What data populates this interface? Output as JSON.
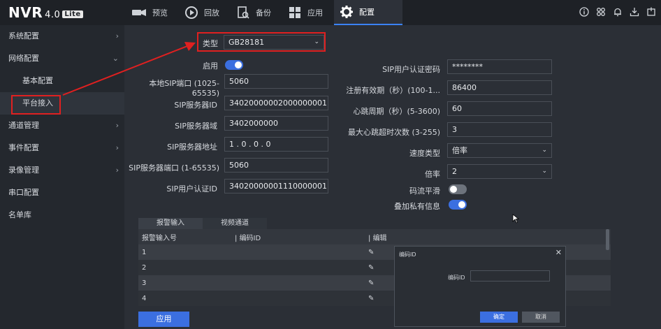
{
  "app": {
    "logo": "NVR",
    "version": "4.0",
    "edition": "Lite"
  },
  "nav": [
    {
      "label": "预览",
      "icon": "camera-icon"
    },
    {
      "label": "回放",
      "icon": "playback-icon"
    },
    {
      "label": "备份",
      "icon": "backup-icon"
    },
    {
      "label": "应用",
      "icon": "apps-icon"
    },
    {
      "label": "配置",
      "icon": "gear-icon"
    }
  ],
  "sidebar": {
    "items": [
      {
        "label": "系统配置"
      },
      {
        "label": "网络配置"
      },
      {
        "label": "基本配置"
      },
      {
        "label": "平台接入"
      },
      {
        "label": "通道管理"
      },
      {
        "label": "事件配置"
      },
      {
        "label": "录像管理"
      },
      {
        "label": "串口配置"
      },
      {
        "label": "名单库"
      }
    ]
  },
  "form": {
    "type_label": "类型",
    "type_value": "GB28181",
    "enable_label": "启用",
    "local_sip_port_label": "本地SIP端口 (1025-65535)",
    "local_sip_port_value": "5060",
    "sip_server_id_label": "SIP服务器ID",
    "sip_server_id_value": "34020000002000000001",
    "sip_server_domain_label": "SIP服务器域",
    "sip_server_domain_value": "3402000000",
    "sip_server_addr_label": "SIP服务器地址",
    "sip_server_addr_value": "1 . 0 . 0 . 0",
    "sip_server_port_label": "SIP服务器端口 (1-65535)",
    "sip_server_port_value": "5060",
    "sip_user_id_label": "SIP用户认证ID",
    "sip_user_id_value": "34020000001110000001",
    "sip_password_label": "SIP用户认证密码",
    "sip_password_value": "********",
    "register_period_label": "注册有效期（秒）(100-1...",
    "register_period_value": "86400",
    "heartbeat_label": "心跳周期（秒）(5-3600)",
    "heartbeat_value": "60",
    "max_timeout_label": "最大心跳超时次数 (3-255)",
    "max_timeout_value": "3",
    "speed_type_label": "速度类型",
    "speed_type_value": "倍率",
    "rate_label": "倍率",
    "rate_value": "2",
    "stream_smooth_label": "码流平滑",
    "private_info_label": "叠加私有信息"
  },
  "table": {
    "tabs": [
      "报警输入",
      "视频通道"
    ],
    "headers": [
      "报警输入号",
      "编码ID",
      "编辑"
    ],
    "rows": [
      "1",
      "2",
      "3",
      "4"
    ]
  },
  "modal": {
    "title": "编码ID",
    "field_label": "编码ID",
    "ok": "确定",
    "cancel": "取消"
  },
  "apply_label": "应用"
}
